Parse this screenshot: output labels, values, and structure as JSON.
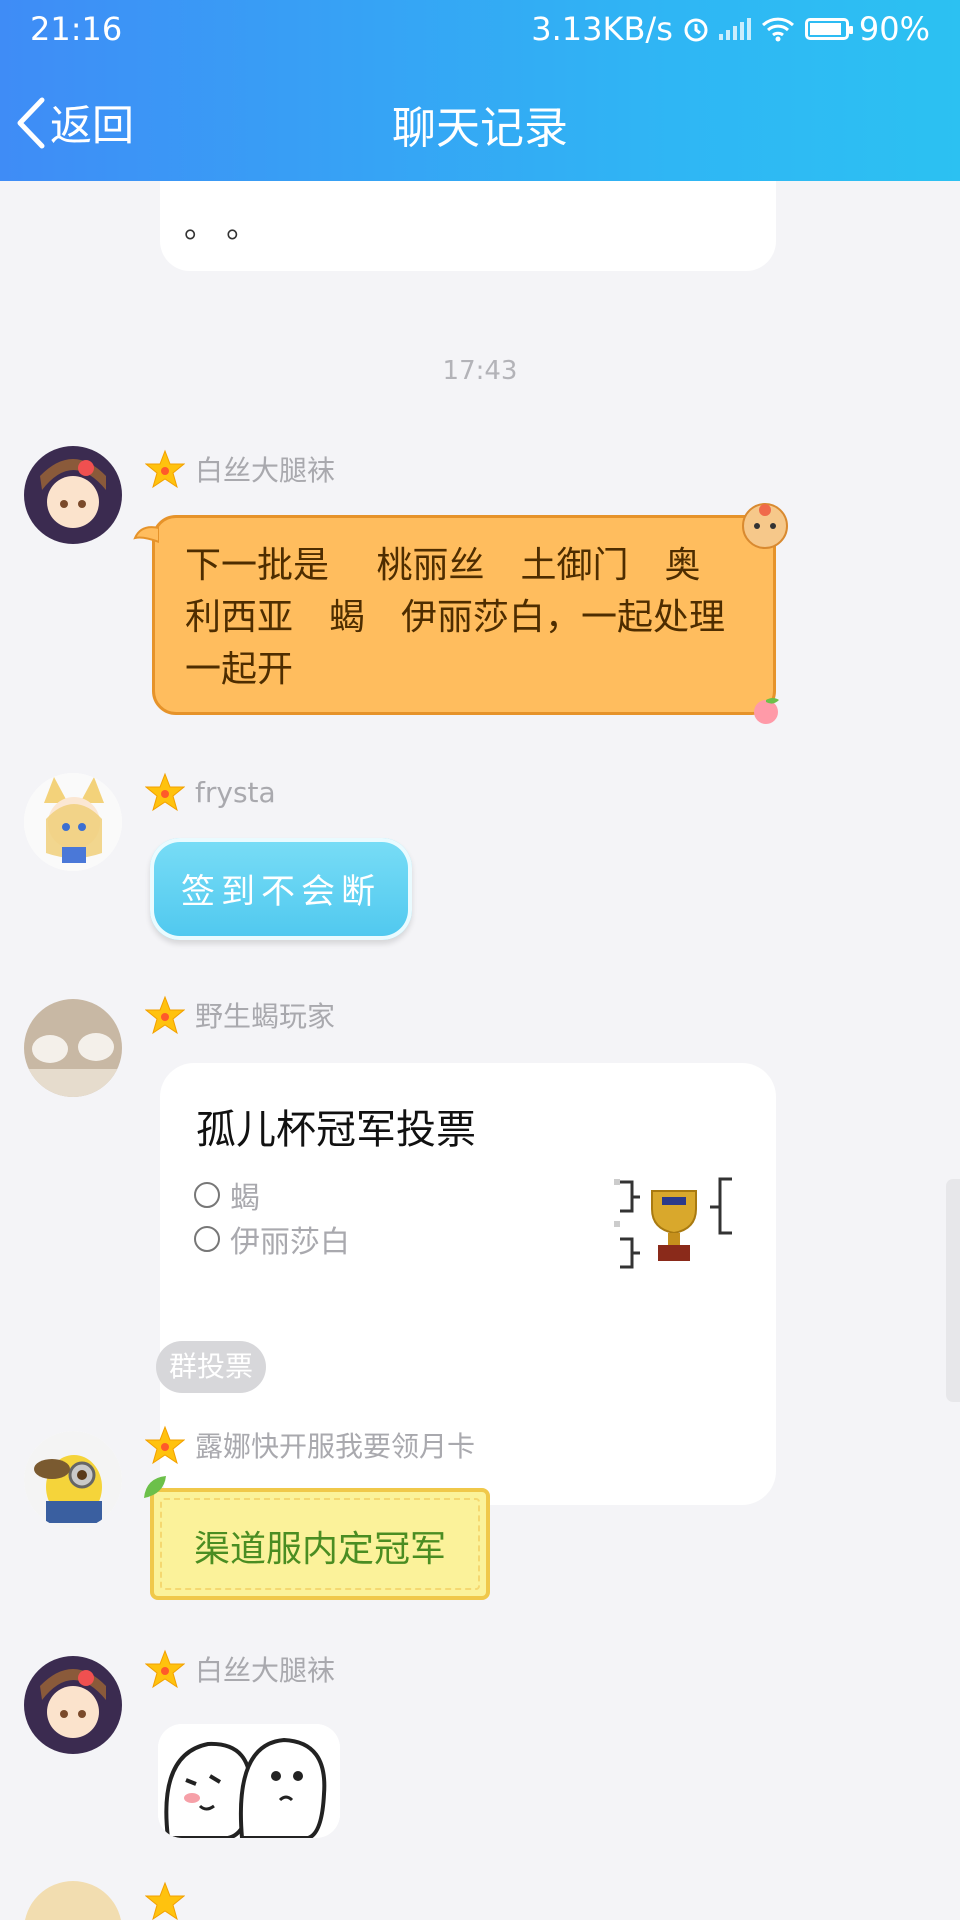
{
  "status_bar": {
    "time": "21:16",
    "speed": "3.13KB/s",
    "battery_percent": "90%",
    "battery_level": 0.9
  },
  "nav": {
    "back_label": "返回",
    "title": "聊天记录"
  },
  "messages": {
    "prev_snippet": "。 。",
    "timestamp": "17:43",
    "m1": {
      "sender": "白丝大腿袜",
      "text": "下一批是　 桃丽丝　土御门　奥利西亚　蝎　伊丽莎白，一起处理一起开"
    },
    "m2": {
      "sender": "frysta",
      "text": "签到不会断"
    },
    "m3": {
      "sender": "野生蝎玩家",
      "poll_title": "孤儿杯冠军投票",
      "options": [
        "蝎",
        "伊丽莎白"
      ],
      "tag": "群投票"
    },
    "m4": {
      "sender": "露娜快开服我要领月卡",
      "text": "渠道服内定冠军"
    },
    "m5": {
      "sender": "白丝大腿袜"
    }
  },
  "colors": {
    "header_start": "#3f8cf6",
    "header_end": "#2cc1f2",
    "orange_bubble": "#ffbd5e",
    "blue_bubble": "#4fc8ef",
    "yellow_bubble": "#fbf29a"
  }
}
